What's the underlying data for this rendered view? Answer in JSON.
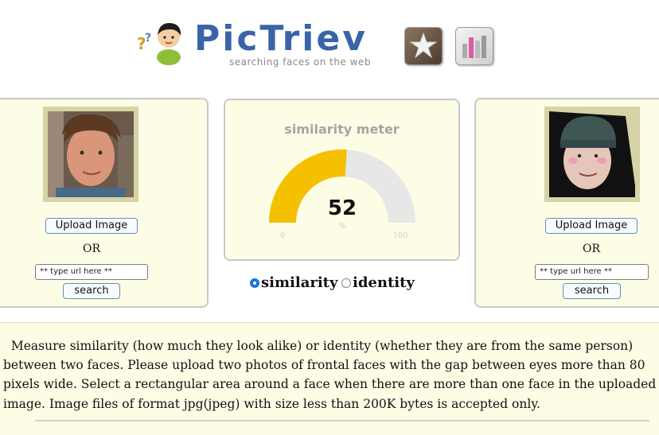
{
  "header": {
    "title": "PicTriev",
    "tagline": "searching faces on the web",
    "icons": [
      {
        "name": "star-icon",
        "color": "#6f5d4c"
      },
      {
        "name": "bar-chart-icon",
        "color": "#e05aa0"
      }
    ]
  },
  "left_panel": {
    "upload_label": "Upload Image",
    "or_label": "OR",
    "url_placeholder": "** type url here **",
    "search_label": "search"
  },
  "right_panel": {
    "upload_label": "Upload Image",
    "or_label": "OR",
    "url_placeholder": "** type url here **",
    "search_label": "search"
  },
  "meter": {
    "title": "similarity meter",
    "value": 52,
    "value_text": "52",
    "unit": "%",
    "min": "0",
    "max": "100",
    "fill_color": "#f5c000",
    "track_color": "#e7e7e7"
  },
  "mode": {
    "options": [
      "similarity",
      "identity"
    ],
    "selected": "similarity"
  },
  "description": "  Measure similarity (how much they look alike) or identity (whether they are from the same person) between two faces. Please upload two photos of frontal faces with the gap between eyes more than 80 pixels wide. Select a rectangular area around a face when there are more than one face in the uploaded image. Image files of format jpg(jpeg) with size less than 200K bytes is accepted only."
}
